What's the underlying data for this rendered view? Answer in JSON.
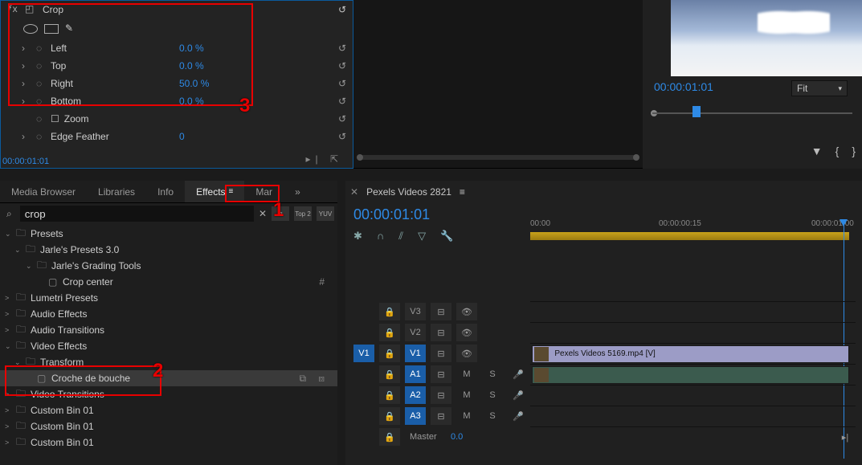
{
  "fx": {
    "title": "Crop",
    "rows": [
      {
        "label": "Left",
        "value": "0.0 %"
      },
      {
        "label": "Top",
        "value": "0.0 %"
      },
      {
        "label": "Right",
        "value": "50.0 %"
      },
      {
        "label": "Bottom",
        "value": "0.0 %"
      }
    ],
    "zoom_label": "Zoom",
    "feather": {
      "label": "Edge Feather",
      "value": "0"
    },
    "timecode": "00:00:01:01"
  },
  "program": {
    "timecode": "00:00:01:01",
    "fit": "Fit"
  },
  "project": {
    "tabs": [
      "Media Browser",
      "Libraries",
      "Info",
      "Effects",
      "Mar"
    ],
    "active_tab": 3,
    "search_value": "crop",
    "top2": "Top 2",
    "yuv": "YUV",
    "tree": [
      {
        "d": 0,
        "open": true,
        "t": "folder",
        "label": "Presets"
      },
      {
        "d": 1,
        "open": true,
        "t": "folder",
        "label": "Jarle's Presets 3.0"
      },
      {
        "d": 2,
        "open": true,
        "t": "folder",
        "label": "Jarle's Grading Tools"
      },
      {
        "d": 3,
        "open": false,
        "t": "item",
        "label": "Crop center",
        "tag": "#"
      },
      {
        "d": 0,
        "open": false,
        "t": "folder",
        "label": "Lumetri Presets",
        "arrow": ">"
      },
      {
        "d": 0,
        "open": false,
        "t": "folder",
        "label": "Audio Effects",
        "arrow": ">"
      },
      {
        "d": 0,
        "open": false,
        "t": "folder",
        "label": "Audio Transitions",
        "arrow": ">"
      },
      {
        "d": 0,
        "open": true,
        "t": "folder",
        "label": "Video Effects"
      },
      {
        "d": 1,
        "open": true,
        "t": "folder",
        "label": "Transform"
      },
      {
        "d": 2,
        "open": false,
        "t": "item",
        "label": "Croche de bouche",
        "sel": true,
        "tag": "⧉   ⧇"
      },
      {
        "d": 0,
        "open": false,
        "t": "folder",
        "label": "Video Transitions",
        "arrow": ">"
      },
      {
        "d": 0,
        "open": false,
        "t": "folder",
        "label": "Custom Bin 01",
        "arrow": ">"
      },
      {
        "d": 0,
        "open": false,
        "t": "folder",
        "label": "Custom Bin 01",
        "arrow": ">"
      },
      {
        "d": 0,
        "open": false,
        "t": "folder",
        "label": "Custom Bin 01",
        "arrow": ">"
      }
    ]
  },
  "timeline": {
    "sequence": "Pexels Videos 2821",
    "timecode": "00:00:01:01",
    "ruler": [
      "00:00",
      "00:00:00:15",
      "00:00:01:00"
    ],
    "track_v": [
      "V3",
      "V2",
      "V1"
    ],
    "track_a": [
      "A1",
      "A2",
      "A3"
    ],
    "master": "Master",
    "master_val": "0.0",
    "clip_name": "Pexels Videos 5169.mp4 [V]",
    "m": "M",
    "s": "S"
  },
  "callouts": {
    "n1": "1",
    "n2": "2",
    "n3": "3"
  }
}
